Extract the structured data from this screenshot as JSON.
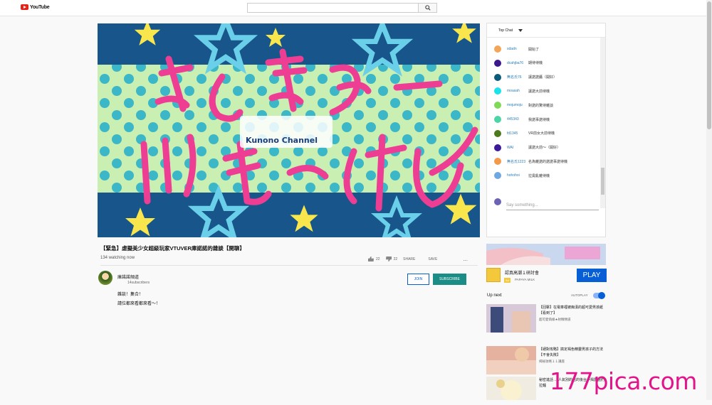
{
  "header": {
    "logo": "YouTube",
    "search_placeholder": ""
  },
  "video": {
    "title": "【緊急】虛擬美少女超級玩家VTUVER庫諾諾的雜談【開聊】",
    "views": "134 watching now",
    "likes": "22",
    "dislikes": "22",
    "share_label": "SHARE",
    "save_label": "SAVE",
    "more_label": "..."
  },
  "channel": {
    "name": "庫諾諾頻道",
    "subs": "14subscribers",
    "join_label": "JOIN",
    "subscribe_label": "SUBSCRIBE",
    "desc_lines": [
      "雜談！集合！",
      "請位都來看都來看～！"
    ]
  },
  "chat": {
    "header_label": "Top Chat",
    "messages": [
      {
        "name": "sdadn",
        "text": "開始了",
        "color": "#f2a65a"
      },
      {
        "name": "dcahjba76",
        "text": "期待待機",
        "color": "#3a1a8a"
      },
      {
        "name": "無名氏76",
        "text": "讓諾諾醬（開好）",
        "color": "#0d5b7b"
      },
      {
        "name": "moasah",
        "text": "讓諾大前待機",
        "color": "#19e2e8"
      },
      {
        "name": "mojumoju",
        "text": "對諾的驚待雜談",
        "color": "#7ed957"
      },
      {
        "name": "445343",
        "text": "我諾事諾待機",
        "color": "#4dd4a8"
      },
      {
        "name": "fd1345",
        "text": "VR前女大前待機",
        "color": "#4d7a1a"
      },
      {
        "name": "WAI",
        "text": "讓諾大前～（開好）",
        "color": "#3a1a9a"
      },
      {
        "name": "無名氏1223",
        "text": "名為雜諾的諾諾事諾待機",
        "color": "#f29a4a"
      },
      {
        "name": "hohohoi",
        "text": "拉奧亂雜待機",
        "color": "#6fa8e0"
      }
    ],
    "input_placeholder": "Say something..."
  },
  "ad": {
    "title": "認真高潮１研討會",
    "tag": "Ad",
    "brand": "PAPAYA MILK",
    "play_label": "PLAY"
  },
  "upnext": {
    "label": "Up next",
    "autoplay_label": "AUTOPLAY",
    "items": [
      {
        "title": "【回擊】在電車裡被痴漢的超可愛男孩紙【看到了】",
        "channel": "超可愛偽娘★射精頻道"
      },
      {
        "title": "【絕對攻略】搞定褐色精靈男孩子的方法【不會失敗】",
        "channel": "揭秘攻略１１講座"
      },
      {
        "title": "秘密進話 ... 人氣別的店的後台～揭露諾們拉麵",
        "channel": "..."
      }
    ]
  },
  "watermark": "177pica.com"
}
